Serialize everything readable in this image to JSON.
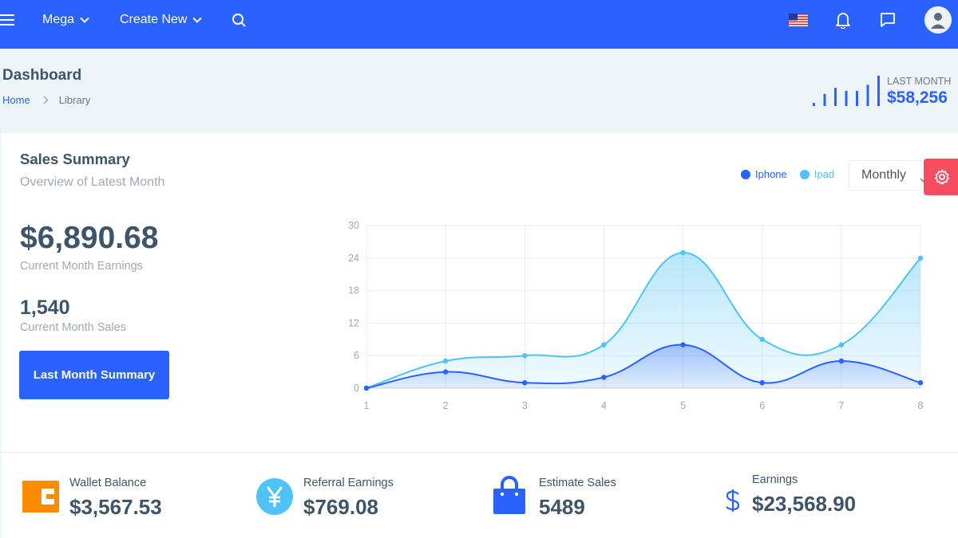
{
  "topbar": {
    "mega_label": "Mega",
    "create_label": "Create New",
    "icons": [
      "menu-icon",
      "chevron-down-icon",
      "search-icon",
      "us-flag-icon",
      "bell-icon",
      "message-icon",
      "user-avatar"
    ]
  },
  "header": {
    "title": "Dashboard",
    "breadcrumb": {
      "home": "Home",
      "current": "Library"
    },
    "last_month": {
      "label": "LAST MONTH",
      "value": "$58,256",
      "spark": [
        1,
        4,
        6,
        5,
        5,
        7,
        10
      ]
    }
  },
  "card": {
    "title": "Sales Summary",
    "subtitle": "Overview of Latest Month",
    "select_value": "Monthly",
    "earnings_value": "$6,890.68",
    "earnings_label": "Current Month Earnings",
    "sales_value": "1,540",
    "sales_label": "Current Month Sales",
    "button_label": "Last Month Summary"
  },
  "chart_data": {
    "type": "area",
    "x": [
      1,
      2,
      3,
      4,
      5,
      6,
      7,
      8
    ],
    "ylim": [
      0,
      30
    ],
    "yticks": [
      0,
      6,
      12,
      18,
      24,
      30
    ],
    "grid": true,
    "legend_position": "top-right",
    "series": [
      {
        "name": "Iphone",
        "color": "#2962ff",
        "values": [
          0,
          3,
          1,
          2,
          8,
          1,
          5,
          1
        ]
      },
      {
        "name": "Ipad",
        "color": "#4fc3f7",
        "values": [
          0,
          5,
          6,
          8,
          25,
          9,
          8,
          24
        ]
      }
    ]
  },
  "stats": [
    {
      "label": "Wallet Balance",
      "value": "$3,567.53",
      "icon": "wallet-icon",
      "color": "#fb8c00"
    },
    {
      "label": "Referral Earnings",
      "value": "$769.08",
      "icon": "yen-icon",
      "color": "#4fc3f7"
    },
    {
      "label": "Estimate Sales",
      "value": "5489",
      "icon": "shopping-bag-icon",
      "color": "#2962ff"
    },
    {
      "label": "Earnings",
      "value": "$23,568.90",
      "icon": "dollar-icon",
      "color": "#2962ff"
    }
  ]
}
